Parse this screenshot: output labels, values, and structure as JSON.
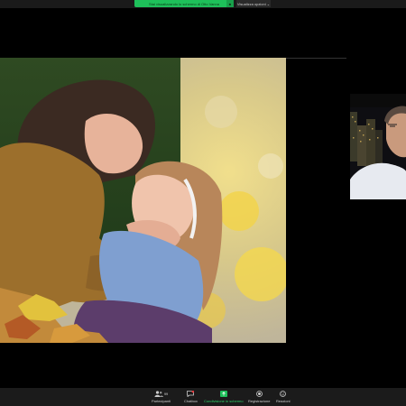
{
  "banner": {
    "text": "Stai visualizzando lo schermo di Otto Vanna",
    "button": "■"
  },
  "view_options": {
    "label": "Visualizza opzioni ⌄"
  },
  "toolbar": {
    "participants": {
      "label": "Partecipanti",
      "count": "99"
    },
    "chat": {
      "label": "Chatbox"
    },
    "share": {
      "label": "Condivisione in schermo"
    },
    "record": {
      "label": "Registrazione"
    },
    "reactions": {
      "label": "Reazioni"
    }
  },
  "colors": {
    "share_green": "#1ec05a",
    "toolbar_bg": "#1b1b1b",
    "chat_badge": "#e5383b"
  }
}
